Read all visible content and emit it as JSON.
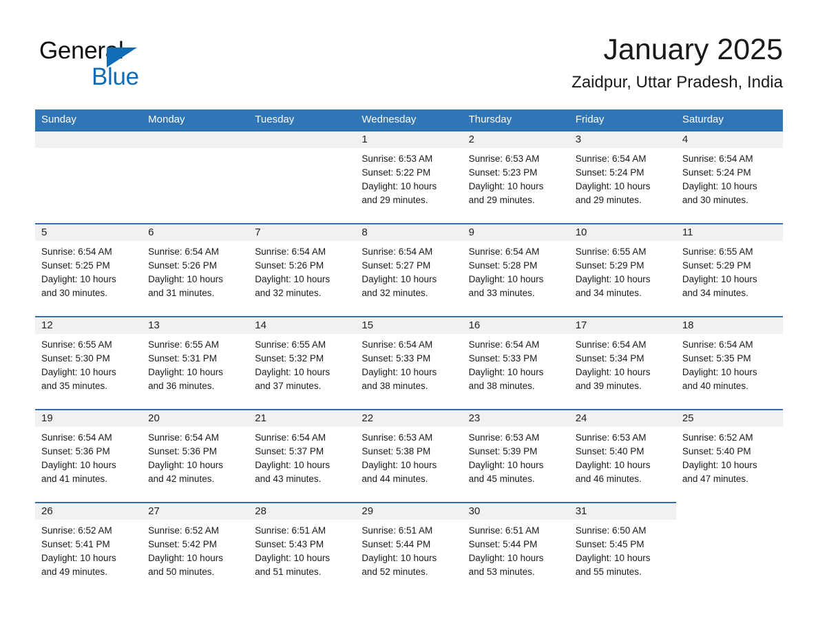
{
  "brand": {
    "name_part1": "General",
    "name_part2": "Blue",
    "triangle_color": "#0f6cb6",
    "blue_color": "#0f6cb6"
  },
  "header": {
    "month_title": "January 2025",
    "location": "Zaidpur, Uttar Pradesh, India"
  },
  "theme": {
    "header_bg": "#3075b5",
    "row_rule": "#2f6fab",
    "daynum_bg": "#f1f1f1"
  },
  "weekday_headers": [
    "Sunday",
    "Monday",
    "Tuesday",
    "Wednesday",
    "Thursday",
    "Friday",
    "Saturday"
  ],
  "labels": {
    "sunrise_prefix": "Sunrise:",
    "sunset_prefix": "Sunset:",
    "daylight_prefix": "Daylight:"
  },
  "weeks": [
    [
      {
        "day": "",
        "line1": "",
        "line2": "",
        "line3": "",
        "line4": ""
      },
      {
        "day": "",
        "line1": "",
        "line2": "",
        "line3": "",
        "line4": ""
      },
      {
        "day": "",
        "line1": "",
        "line2": "",
        "line3": "",
        "line4": ""
      },
      {
        "day": "1",
        "line1": "Sunrise: 6:53 AM",
        "line2": "Sunset: 5:22 PM",
        "line3": "Daylight: 10 hours",
        "line4": "and 29 minutes."
      },
      {
        "day": "2",
        "line1": "Sunrise: 6:53 AM",
        "line2": "Sunset: 5:23 PM",
        "line3": "Daylight: 10 hours",
        "line4": "and 29 minutes."
      },
      {
        "day": "3",
        "line1": "Sunrise: 6:54 AM",
        "line2": "Sunset: 5:24 PM",
        "line3": "Daylight: 10 hours",
        "line4": "and 29 minutes."
      },
      {
        "day": "4",
        "line1": "Sunrise: 6:54 AM",
        "line2": "Sunset: 5:24 PM",
        "line3": "Daylight: 10 hours",
        "line4": "and 30 minutes."
      }
    ],
    [
      {
        "day": "5",
        "line1": "Sunrise: 6:54 AM",
        "line2": "Sunset: 5:25 PM",
        "line3": "Daylight: 10 hours",
        "line4": "and 30 minutes."
      },
      {
        "day": "6",
        "line1": "Sunrise: 6:54 AM",
        "line2": "Sunset: 5:26 PM",
        "line3": "Daylight: 10 hours",
        "line4": "and 31 minutes."
      },
      {
        "day": "7",
        "line1": "Sunrise: 6:54 AM",
        "line2": "Sunset: 5:26 PM",
        "line3": "Daylight: 10 hours",
        "line4": "and 32 minutes."
      },
      {
        "day": "8",
        "line1": "Sunrise: 6:54 AM",
        "line2": "Sunset: 5:27 PM",
        "line3": "Daylight: 10 hours",
        "line4": "and 32 minutes."
      },
      {
        "day": "9",
        "line1": "Sunrise: 6:54 AM",
        "line2": "Sunset: 5:28 PM",
        "line3": "Daylight: 10 hours",
        "line4": "and 33 minutes."
      },
      {
        "day": "10",
        "line1": "Sunrise: 6:55 AM",
        "line2": "Sunset: 5:29 PM",
        "line3": "Daylight: 10 hours",
        "line4": "and 34 minutes."
      },
      {
        "day": "11",
        "line1": "Sunrise: 6:55 AM",
        "line2": "Sunset: 5:29 PM",
        "line3": "Daylight: 10 hours",
        "line4": "and 34 minutes."
      }
    ],
    [
      {
        "day": "12",
        "line1": "Sunrise: 6:55 AM",
        "line2": "Sunset: 5:30 PM",
        "line3": "Daylight: 10 hours",
        "line4": "and 35 minutes."
      },
      {
        "day": "13",
        "line1": "Sunrise: 6:55 AM",
        "line2": "Sunset: 5:31 PM",
        "line3": "Daylight: 10 hours",
        "line4": "and 36 minutes."
      },
      {
        "day": "14",
        "line1": "Sunrise: 6:55 AM",
        "line2": "Sunset: 5:32 PM",
        "line3": "Daylight: 10 hours",
        "line4": "and 37 minutes."
      },
      {
        "day": "15",
        "line1": "Sunrise: 6:54 AM",
        "line2": "Sunset: 5:33 PM",
        "line3": "Daylight: 10 hours",
        "line4": "and 38 minutes."
      },
      {
        "day": "16",
        "line1": "Sunrise: 6:54 AM",
        "line2": "Sunset: 5:33 PM",
        "line3": "Daylight: 10 hours",
        "line4": "and 38 minutes."
      },
      {
        "day": "17",
        "line1": "Sunrise: 6:54 AM",
        "line2": "Sunset: 5:34 PM",
        "line3": "Daylight: 10 hours",
        "line4": "and 39 minutes."
      },
      {
        "day": "18",
        "line1": "Sunrise: 6:54 AM",
        "line2": "Sunset: 5:35 PM",
        "line3": "Daylight: 10 hours",
        "line4": "and 40 minutes."
      }
    ],
    [
      {
        "day": "19",
        "line1": "Sunrise: 6:54 AM",
        "line2": "Sunset: 5:36 PM",
        "line3": "Daylight: 10 hours",
        "line4": "and 41 minutes."
      },
      {
        "day": "20",
        "line1": "Sunrise: 6:54 AM",
        "line2": "Sunset: 5:36 PM",
        "line3": "Daylight: 10 hours",
        "line4": "and 42 minutes."
      },
      {
        "day": "21",
        "line1": "Sunrise: 6:54 AM",
        "line2": "Sunset: 5:37 PM",
        "line3": "Daylight: 10 hours",
        "line4": "and 43 minutes."
      },
      {
        "day": "22",
        "line1": "Sunrise: 6:53 AM",
        "line2": "Sunset: 5:38 PM",
        "line3": "Daylight: 10 hours",
        "line4": "and 44 minutes."
      },
      {
        "day": "23",
        "line1": "Sunrise: 6:53 AM",
        "line2": "Sunset: 5:39 PM",
        "line3": "Daylight: 10 hours",
        "line4": "and 45 minutes."
      },
      {
        "day": "24",
        "line1": "Sunrise: 6:53 AM",
        "line2": "Sunset: 5:40 PM",
        "line3": "Daylight: 10 hours",
        "line4": "and 46 minutes."
      },
      {
        "day": "25",
        "line1": "Sunrise: 6:52 AM",
        "line2": "Sunset: 5:40 PM",
        "line3": "Daylight: 10 hours",
        "line4": "and 47 minutes."
      }
    ],
    [
      {
        "day": "26",
        "line1": "Sunrise: 6:52 AM",
        "line2": "Sunset: 5:41 PM",
        "line3": "Daylight: 10 hours",
        "line4": "and 49 minutes."
      },
      {
        "day": "27",
        "line1": "Sunrise: 6:52 AM",
        "line2": "Sunset: 5:42 PM",
        "line3": "Daylight: 10 hours",
        "line4": "and 50 minutes."
      },
      {
        "day": "28",
        "line1": "Sunrise: 6:51 AM",
        "line2": "Sunset: 5:43 PM",
        "line3": "Daylight: 10 hours",
        "line4": "and 51 minutes."
      },
      {
        "day": "29",
        "line1": "Sunrise: 6:51 AM",
        "line2": "Sunset: 5:44 PM",
        "line3": "Daylight: 10 hours",
        "line4": "and 52 minutes."
      },
      {
        "day": "30",
        "line1": "Sunrise: 6:51 AM",
        "line2": "Sunset: 5:44 PM",
        "line3": "Daylight: 10 hours",
        "line4": "and 53 minutes."
      },
      {
        "day": "31",
        "line1": "Sunrise: 6:50 AM",
        "line2": "Sunset: 5:45 PM",
        "line3": "Daylight: 10 hours",
        "line4": "and 55 minutes."
      },
      {
        "day": "",
        "line1": "",
        "line2": "",
        "line3": "",
        "line4": ""
      }
    ]
  ]
}
